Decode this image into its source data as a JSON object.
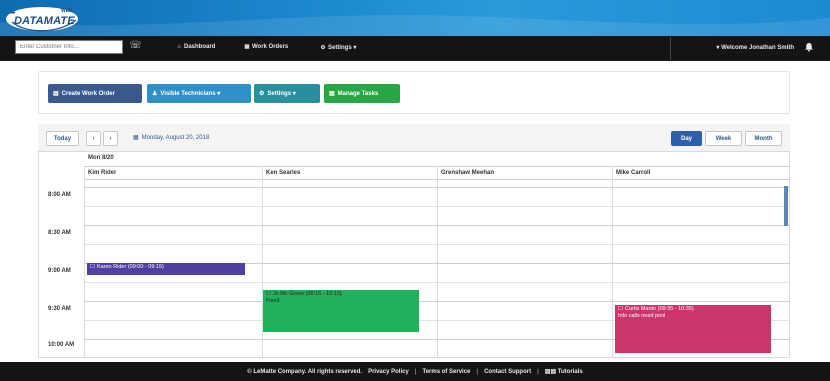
{
  "logo": {
    "brand": "DATAMATE",
    "web": "WEB",
    "dots": "••••"
  },
  "navbar": {
    "search_placeholder": "Enter Customer Info...",
    "links": [
      {
        "icon": "home-icon",
        "glyph": "⌂",
        "label": "Dashboard"
      },
      {
        "icon": "calendar-icon",
        "glyph": "▦",
        "label": "Work Orders"
      },
      {
        "icon": "gear-icon",
        "glyph": "⚙",
        "label": "Settings ▾"
      }
    ],
    "welcome": "▾ Welcome Jonathan Smith"
  },
  "toolbar": {
    "create": {
      "glyph": "▤",
      "label": "Create Work Order"
    },
    "visible": {
      "glyph": "♟",
      "label": "Visible Technicians ▾"
    },
    "settings": {
      "glyph": "⚙",
      "label": "Settings ▾"
    },
    "manage": {
      "glyph": "▤",
      "label": "Manage Tasks"
    }
  },
  "calendar": {
    "today_label": "Today",
    "prev_label": "‹",
    "next_label": "›",
    "date_glyph": "▦",
    "date": "Monday, August 20, 2018",
    "views": {
      "day": "Day",
      "week": "Week",
      "month": "Month"
    },
    "day_header": "Mon 8/20",
    "columns": [
      "Kim Rider",
      "Ken Searles",
      "Grenshaw Meehan",
      "Mike Carroll"
    ],
    "times": [
      "8:00 AM",
      "8:30 AM",
      "9:00 AM",
      "9:30 AM",
      "10:00 AM"
    ],
    "events": {
      "ev1": {
        "title": "Karen Rider (09:00 - 09:15)"
      },
      "ev2": {
        "title": "Jo Mc Grose (09:15 - 10:15)",
        "sub": "Fixed"
      },
      "ev3": {
        "title": "Curtis Martin (09:35 - 10:35)",
        "sub": "Info calls need pool"
      }
    }
  },
  "footer": {
    "copyright": "© LeMatte Company. All rights reserved.",
    "links": [
      "Privacy Policy",
      "Terms of Service",
      "Contact Support"
    ],
    "tutorials": "▤▤ Tutorials"
  },
  "colors": {
    "brand_blue": "#1b86cc",
    "event_purple": "#4f3fa0",
    "event_green": "#1fb15c",
    "event_pink": "#c9366b"
  }
}
